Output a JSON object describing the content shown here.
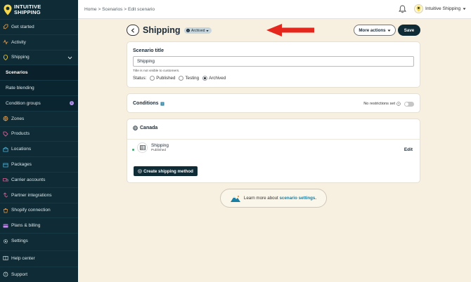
{
  "brand": {
    "line1": "INTUITIVE",
    "line2": "SHIPPING",
    "accent": "#f6d64b"
  },
  "sidebar": {
    "items": [
      {
        "label": "Get started",
        "icon": "rocket-icon"
      },
      {
        "label": "Activity",
        "icon": "activity-icon"
      },
      {
        "label": "Shipping",
        "icon": "shipping-icon"
      },
      {
        "label": "Scenarios",
        "icon": ""
      },
      {
        "label": "Rate blending",
        "icon": ""
      },
      {
        "label": "Condition groups",
        "icon": "",
        "badge": "i"
      },
      {
        "label": "Zones",
        "icon": "zones-icon"
      },
      {
        "label": "Products",
        "icon": "products-icon"
      },
      {
        "label": "Locations",
        "icon": "locations-icon"
      },
      {
        "label": "Packages",
        "icon": "packages-icon"
      },
      {
        "label": "Carrier accounts",
        "icon": "carrier-icon"
      },
      {
        "label": "Partner integrations",
        "icon": "integrations-icon"
      },
      {
        "label": "Shopify connection",
        "icon": "shopify-icon"
      },
      {
        "label": "Plans & billing",
        "icon": "billing-icon"
      },
      {
        "label": "Settings",
        "icon": "gear-icon"
      }
    ],
    "bottom": [
      {
        "label": "Help center",
        "icon": "help-icon"
      },
      {
        "label": "Support",
        "icon": "support-icon"
      }
    ]
  },
  "topbar": {
    "breadcrumb": [
      "Home",
      "Scenarios",
      "Edit scenario"
    ],
    "account": "Intuitive Shipping"
  },
  "header": {
    "title": "Shipping",
    "status_pill": "Archived",
    "more_actions": "More actions",
    "save": "Save"
  },
  "scenario": {
    "label": "Scenario title",
    "value": "Shipping",
    "helper": "Title is not visible to customers.",
    "status_label": "Status:",
    "options": [
      "Published",
      "Testing",
      "Archived"
    ],
    "selected": "Archived"
  },
  "conditions": {
    "title": "Conditions",
    "restriction": "No restrictions set"
  },
  "region": {
    "title": "Canada",
    "method_name": "Shipping",
    "method_status": "Published",
    "edit": "Edit",
    "create": "Create shipping method"
  },
  "learn": {
    "prefix": "Learn more about",
    "link": "scenario settings."
  },
  "colors": {
    "sidebar": "#0e2b36",
    "background": "#f7efdf",
    "arrow": "#e4261c",
    "link": "#1a7fa3"
  }
}
